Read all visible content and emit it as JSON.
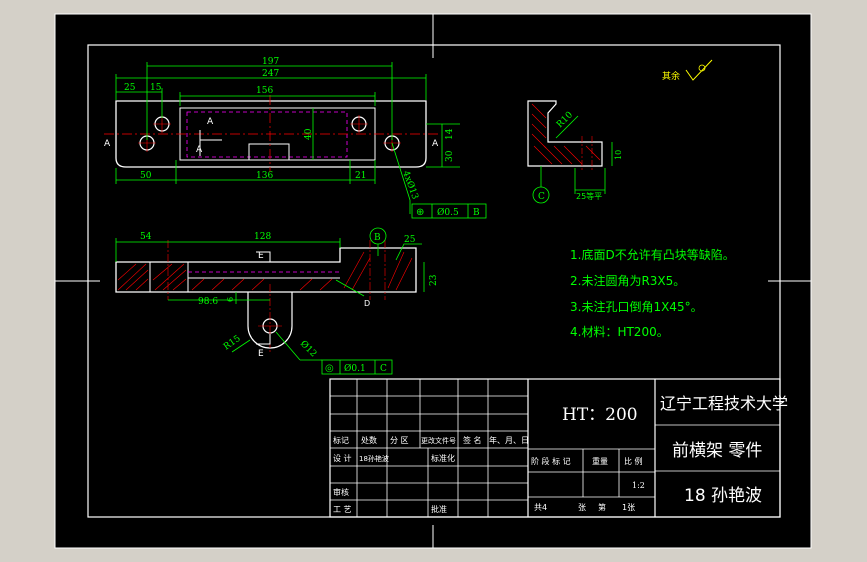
{
  "colors": {
    "app_bg": "#d4d0c8",
    "sheet_bg": "#000000",
    "frame": "#ffffff",
    "dimension": "#00ff00",
    "hatch": "#ff0000",
    "centerline": "#ff0000",
    "part": "#ffffff",
    "hidden": "#ff00ff",
    "note": "#ffff00",
    "title_text": "#ffffff"
  },
  "top_view": {
    "dims": {
      "overall_197": "197",
      "overall_247": "247",
      "left_25": "25",
      "left_15": "15",
      "slot_156": "156",
      "height_40": "40",
      "right_14": "14",
      "right_30": "30",
      "bottom_50": "50",
      "bottom_136": "136",
      "bottom_21": "21"
    },
    "section_labels": [
      "A",
      "A",
      "A",
      "A"
    ],
    "hole_callout": "4xØ13",
    "tolerance": {
      "symbol": "⊕",
      "value": "Ø0.5",
      "datum": "B"
    }
  },
  "side_view": {
    "radius_label": "R10",
    "width_label": "25等平",
    "height_label": "10",
    "datum_label": "C"
  },
  "front_view": {
    "dims": {
      "left_54": "54",
      "top_128": "128",
      "right_23": "23",
      "mid_98_6": "98.6",
      "small_6": "6",
      "angle_25": "25"
    },
    "section_labels": [
      "E",
      "E"
    ],
    "datum_b": "B",
    "datum_d": "D",
    "lug_radius": "R15",
    "lug_hole": "Ø12",
    "tolerance": {
      "symbol": "◎",
      "value": "Ø0.1",
      "datum": "C"
    }
  },
  "roughness": {
    "label": "其余"
  },
  "notes": [
    "1.底面D不允许有凸块等缺陷。",
    "2.未注圆角为R3X5。",
    "3.未注孔口倒角1X45°。",
    "4.材料：HT200。"
  ],
  "title_block": {
    "material": "HT：200",
    "school": "辽宁工程技术大学",
    "part_name": "前横架 零件",
    "author": "18 孙艳波",
    "headers": [
      "标记",
      "处数",
      "分 区",
      "更改文件号",
      "签 名",
      "年、月、日"
    ],
    "row_design": [
      "设 计",
      "18孙艳波",
      "标准化"
    ],
    "row_review": "审核",
    "row_process": "工 艺",
    "row_approve": "批准",
    "stage_headers": [
      "阶 段 标 记",
      "重量",
      "比 例"
    ],
    "scale": "1:2",
    "sheets": [
      "共4",
      "张",
      "第",
      "1张"
    ]
  }
}
